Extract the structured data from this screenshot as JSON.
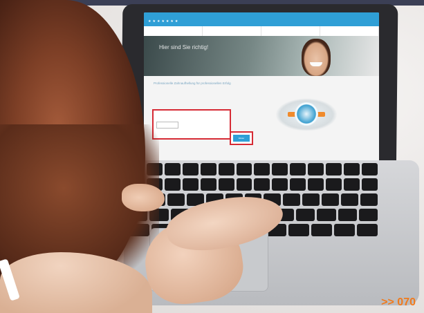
{
  "page_ref": ">> 070",
  "screen": {
    "hero_title": "Hier sind Sie richtig!",
    "form_title": "Professionelle Zahnaufhellung für professionellen Erfolg",
    "submit_label": "Weiter",
    "colors": {
      "brand_blue": "#2f9fd6",
      "highlight_red": "#d62a34",
      "accent_orange": "#f07a1c"
    }
  }
}
